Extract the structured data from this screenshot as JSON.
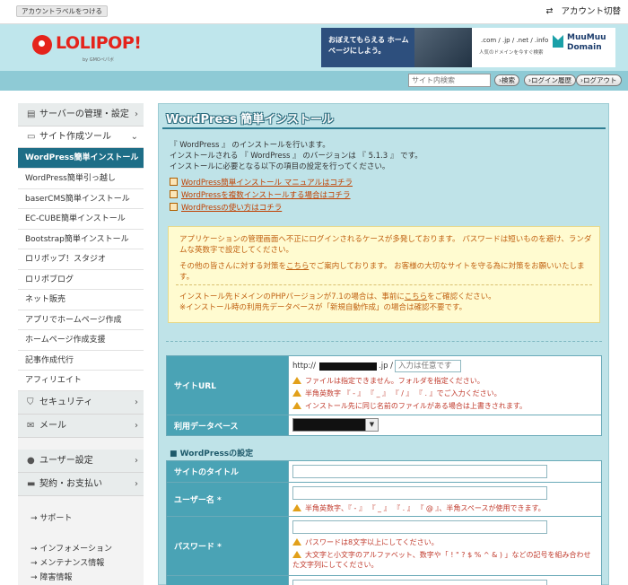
{
  "topbar": {
    "label_button": "アカウントラベルをつける",
    "account_switch": "アカウント切替"
  },
  "header": {
    "logo_text": "LOLIPOP!",
    "logo_sub": "by GMOペパボ",
    "banner1_text": "おぼえてもらえる ホームページにしよう。",
    "banner2_domains": ".com / .jp / .net / .info",
    "banner2_sub": "人気のドメインを今すぐ検索",
    "banner2_brand": "MuuMuu Domain"
  },
  "toolbar": {
    "search_placeholder": "サイト内検索",
    "search_btn": "検索",
    "login_history_btn": "ログイン履歴",
    "logout_btn": "ログアウト"
  },
  "sidebar": {
    "cat_server": "サーバーの管理・設定",
    "cat_site": "サイト作成ツール",
    "items": [
      "WordPress簡単インストール",
      "WordPress簡単引っ越し",
      "baserCMS簡単インストール",
      "EC-CUBE簡単インストール",
      "Bootstrap簡単インストール",
      "ロリポップ！スタジオ",
      "ロリポブログ",
      "ネット販売",
      "アプリでホームページ作成",
      "ホームページ作成支援",
      "記事作成代行",
      "アフィリエイト"
    ],
    "cat_security": "セキュリティ",
    "cat_mail": "メール",
    "cat_user": "ユーザー設定",
    "cat_contract": "契約・お支払い",
    "support": "サポート",
    "info": "インフォメーション",
    "maintenance": "メンテナンス情報",
    "trouble": "障害情報"
  },
  "main": {
    "title": "WordPress 簡単インストール",
    "intro": [
      "『 WordPress 』 のインストールを行います。",
      "インストールされる 『 WordPress 』 のバージョンは 『 5.1.3 』 です。",
      "インストールに必要となる以下の項目の設定を行ってください。"
    ],
    "links": [
      "WordPress簡単インストール マニュアルはコチラ",
      "WordPressを複数インストールする場合はコチラ",
      "WordPressの使い方はコチラ"
    ],
    "notice": {
      "p1": "アプリケーションの管理画面へ不正にログインされるケースが多発しております。 パスワードは短いものを避け、ランダムな英数字で設定してください。",
      "p2_before": "その他の皆さんに対する対策を",
      "p2_link": "こちら",
      "p2_after": "でご案内しております。 お客様の大切なサイトを守る為に対策をお願いいたします。",
      "p3_before": "インストール先ドメインのPHPバージョンが7.1の場合は、事前に",
      "p3_link": "こちら",
      "p3_after": "をご確認ください。",
      "p4": "※インストール時の利用先データベースが「新規自動作成」の場合は確認不要です。"
    },
    "form": {
      "site_url_label": "サイトURL",
      "url_prefix": "http://",
      "url_tld": ".jp /",
      "url_input_placeholder": "入力は任意です",
      "url_warns": [
        "ファイルは指定できません。フォルダを指定ください。",
        "半角英数字 『 - 』 『 _ 』 『 / 』 『 . 』でご入力ください。",
        "インストール先に同じ名前のファイルがある場合は上書きされます。"
      ],
      "db_label": "利用データベース",
      "wp_settings_heading": "■ WordPressの設定",
      "site_title_label": "サイトのタイトル",
      "username_label": "ユーザー名 *",
      "username_warn": "半角英数字、『 - 』 『 _ 』 『 . 』 『 @ 』、半角スペースが使用できます。",
      "password_label": "パスワード *",
      "password_warns": [
        "パスワードは8文字以上にしてください。",
        "大文字と小文字のアルファベット、数字や「 ! \" ? $ % ^ & ) 」などの記号を組み合わせた文字列にしてください。"
      ]
    }
  }
}
